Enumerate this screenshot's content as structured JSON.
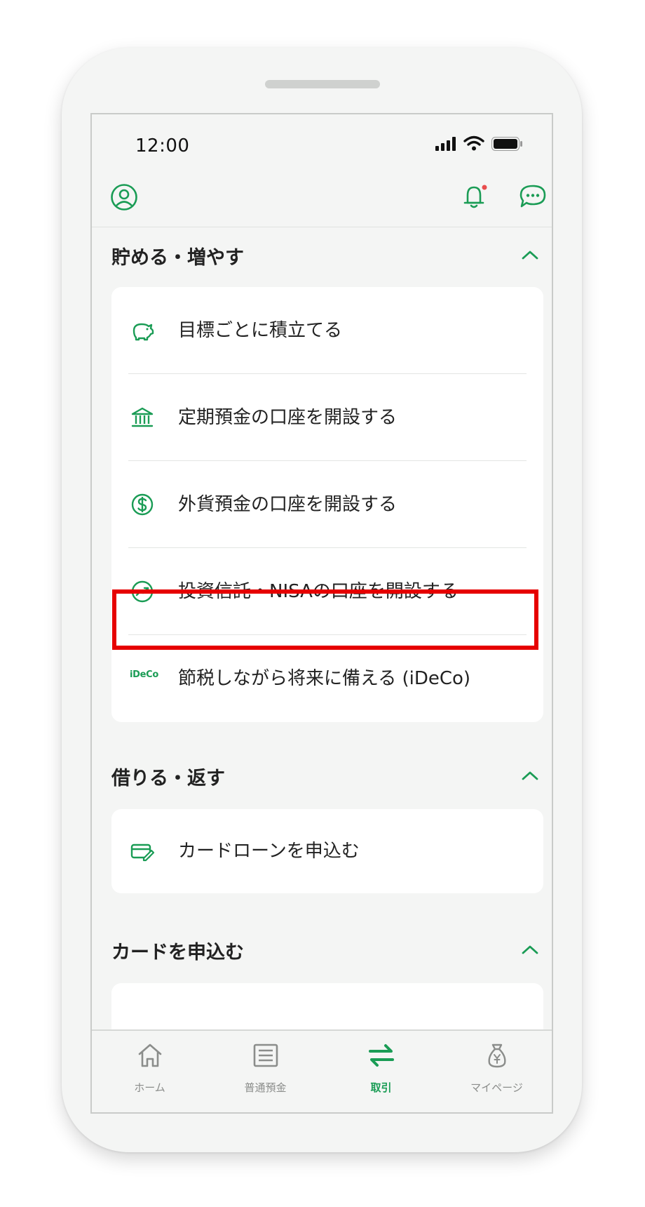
{
  "colors": {
    "accent": "#1a9c55",
    "highlight": "#e60000",
    "badge": "#e84d4d"
  },
  "status_bar": {
    "time": "12:00"
  },
  "header": {
    "icons": [
      "profile-icon",
      "bell-icon",
      "chat-icon"
    ]
  },
  "sections": [
    {
      "title": "貯める・増やす",
      "items": [
        {
          "icon": "piggy-bank-icon",
          "label": "目標ごとに積立てる"
        },
        {
          "icon": "bank-icon",
          "label": "定期預金の口座を開設する"
        },
        {
          "icon": "dollar-icon",
          "label": "外貨預金の口座を開設する"
        },
        {
          "icon": "chart-up-icon",
          "label": "投資信託・NISAの口座を開設する"
        },
        {
          "icon_text": "iDeCo",
          "label": "節税しながら将来に備える (iDeCo)"
        }
      ]
    },
    {
      "title": "借りる・返す",
      "items": [
        {
          "icon": "card-edit-icon",
          "label": "カードローンを申込む"
        }
      ]
    },
    {
      "title": "カードを申込む",
      "items": []
    }
  ],
  "tabbar": [
    {
      "icon": "home-icon",
      "label": "ホーム",
      "active": false
    },
    {
      "icon": "list-icon",
      "label": "普通預金",
      "active": false
    },
    {
      "icon": "transfer-icon",
      "label": "取引",
      "active": true
    },
    {
      "icon": "moneybag-icon",
      "label": "マイページ",
      "active": false
    }
  ]
}
